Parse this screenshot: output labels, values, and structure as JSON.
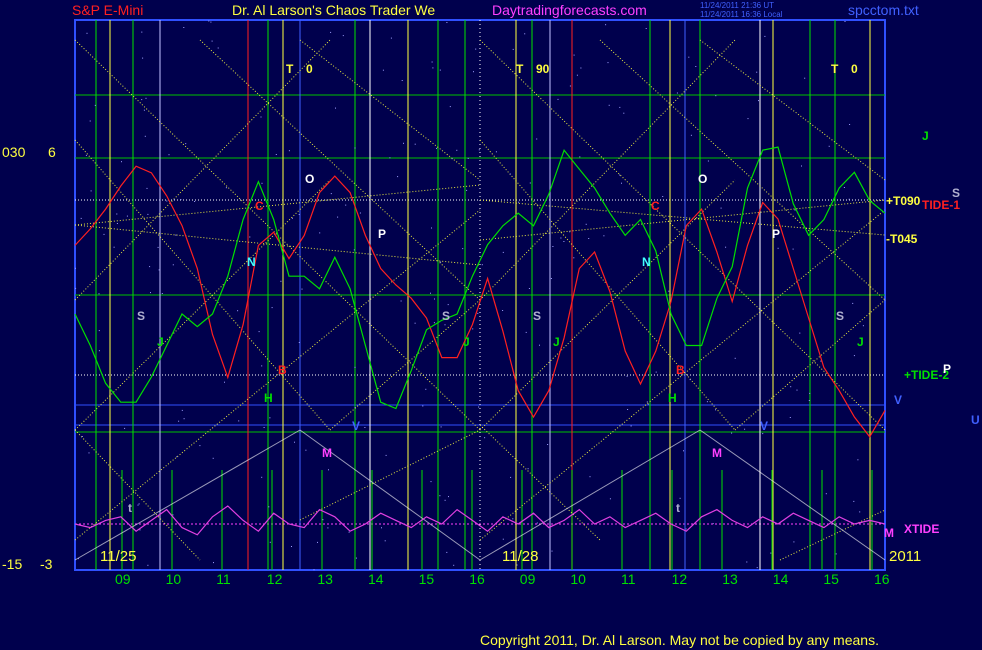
{
  "header": {
    "instrument": "S&P E-Mini",
    "title_part": "Dr. Al Larson's Chaos Trader We",
    "site": "Daytradingforecasts.com",
    "time_line1": "11/24/2011 21:36 UT",
    "time_line2": "11/24/2011 16:36 Local",
    "filename": "spcctom.txt"
  },
  "left_scale": {
    "top_a": "030",
    "top_b": "6",
    "bottom_a": "-15",
    "bottom_b": "-3"
  },
  "footer": {
    "date_left": "11/25",
    "date_mid": "11/28",
    "year": "2011",
    "copyright": "Copyright 2011, Dr. Al Larson. May not be copied by any means."
  },
  "right_labels": {
    "t090": "+T090",
    "tide1": "TIDE-1",
    "t045": "-T045",
    "tide2": "+TIDE-2",
    "xtide": "XTIDE",
    "j": "J",
    "s": "S",
    "p": "P",
    "v": "V",
    "u": "U",
    "m": "M"
  },
  "cycle_headers": {
    "a_letter": "T",
    "a_value": "0",
    "b_letter": "T",
    "b_value": "90",
    "c_letter": "T",
    "c_value": "0"
  },
  "chart_data": {
    "type": "line",
    "x_hours_day1": [
      "09",
      "10",
      "11",
      "12",
      "13",
      "14",
      "15",
      "16"
    ],
    "x_hours_day2": [
      "09",
      "10",
      "11",
      "12",
      "13",
      "14",
      "15",
      "16"
    ],
    "series": [
      {
        "name": "TIDE-1",
        "color": "#ff2020",
        "values": [
          0.62,
          0.67,
          0.73,
          0.8,
          0.86,
          0.84,
          0.77,
          0.68,
          0.55,
          0.35,
          0.22,
          0.38,
          0.62,
          0.66,
          0.58,
          0.65,
          0.78,
          0.83,
          0.78,
          0.65,
          0.55,
          0.5,
          0.46,
          0.4,
          0.28,
          0.28,
          0.38,
          0.52,
          0.36,
          0.18,
          0.1,
          0.18,
          0.34,
          0.55,
          0.6,
          0.48,
          0.3,
          0.2,
          0.3,
          0.45,
          0.68,
          0.73,
          0.6,
          0.45,
          0.62,
          0.75,
          0.7,
          0.55,
          0.4,
          0.25,
          0.18,
          0.1,
          0.04,
          0.12
        ]
      },
      {
        "name": "TIDE-2",
        "color": "#00e000",
        "values": [
          0.4,
          0.3,
          0.18,
          0.12,
          0.12,
          0.2,
          0.3,
          0.4,
          0.36,
          0.4,
          0.52,
          0.7,
          0.82,
          0.7,
          0.52,
          0.52,
          0.48,
          0.58,
          0.48,
          0.3,
          0.12,
          0.1,
          0.22,
          0.35,
          0.38,
          0.4,
          0.52,
          0.62,
          0.68,
          0.72,
          0.68,
          0.78,
          0.92,
          0.86,
          0.8,
          0.72,
          0.65,
          0.7,
          0.6,
          0.4,
          0.3,
          0.3,
          0.45,
          0.55,
          0.8,
          0.92,
          0.93,
          0.75,
          0.65,
          0.7,
          0.8,
          0.85,
          0.76,
          0.72
        ]
      },
      {
        "name": "XTIDE",
        "color": "#e040e0",
        "values": [
          0.5,
          0.45,
          0.55,
          0.6,
          0.4,
          0.55,
          0.7,
          0.45,
          0.35,
          0.6,
          0.75,
          0.55,
          0.4,
          0.65,
          0.5,
          0.45,
          0.7,
          0.6,
          0.4,
          0.5,
          0.65,
          0.55,
          0.45,
          0.6,
          0.5,
          0.7,
          0.55,
          0.4,
          0.6,
          0.5,
          0.65,
          0.45,
          0.55,
          0.7,
          0.5,
          0.6,
          0.45,
          0.55,
          0.65,
          0.5,
          0.4,
          0.6,
          0.7,
          0.55,
          0.45,
          0.6,
          0.5,
          0.65,
          0.55,
          0.45,
          0.6,
          0.5,
          0.55,
          0.5
        ]
      }
    ]
  }
}
